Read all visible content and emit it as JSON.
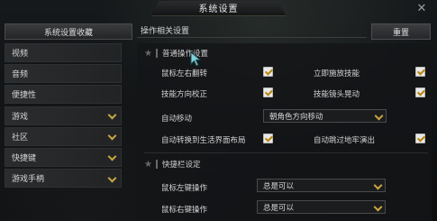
{
  "title": "系统设置",
  "close_icon": "close-icon",
  "left_header": "系统设置收藏",
  "sidebar": {
    "items": [
      {
        "label": "视频",
        "expandable": false
      },
      {
        "label": "音频",
        "expandable": false
      },
      {
        "label": "便捷性",
        "expandable": false
      },
      {
        "label": "游戏",
        "expandable": true
      },
      {
        "label": "社区",
        "expandable": true
      },
      {
        "label": "快捷键",
        "expandable": true
      },
      {
        "label": "游戏手柄",
        "expandable": true
      }
    ]
  },
  "right_header": "操作相关设置",
  "reset_label": "重置",
  "sections": {
    "general": {
      "title": "普通操作设置",
      "rows": {
        "mouse_left_flip": {
          "label": "鼠标左右翻转",
          "checked": true
        },
        "instant_skill": {
          "label": "立即施放技能",
          "checked": true
        },
        "skill_dir_correct": {
          "label": "技能方向校正",
          "checked": true
        },
        "skill_cam_shake": {
          "label": "技能镜头晃动",
          "checked": true
        },
        "auto_move": {
          "label": "自动移动",
          "value": "朝角色方向移动"
        },
        "auto_switch_layout": {
          "label": "自动转换到生活界面布局",
          "checked": true
        },
        "auto_skip_cutscene": {
          "label": "自动跳过地牢演出",
          "checked": true
        }
      }
    },
    "quickbar": {
      "title": "快捷栏设定",
      "rows": {
        "mouse_left_op": {
          "label": "鼠标左键操作",
          "value": "总是可以"
        },
        "mouse_right_op": {
          "label": "鼠标右键操作",
          "value": "总是可以"
        }
      }
    }
  },
  "colors": {
    "accent_gold": "#c9a640",
    "check_mark": "#b8860b"
  }
}
